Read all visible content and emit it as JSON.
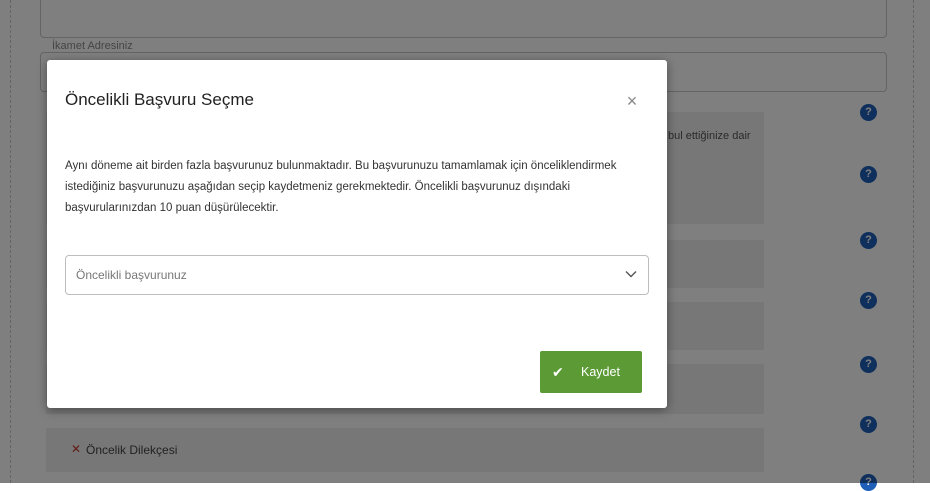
{
  "background": {
    "address_legend": "İkamet Adresiniz",
    "partial_text": "bul ettiğinize dair",
    "priority_row_label": "Öncelik Dilekçesi",
    "help_icon_glyph": "?",
    "remove_glyph": "✕"
  },
  "modal": {
    "title": "Öncelikli Başvuru Seçme",
    "close_glyph": "×",
    "message": "Aynı döneme ait birden fazla başvurunuz bulunmaktadır. Bu başvurunuzu tamamlamak için önceliklendirmek istediğiniz başvurunuzu aşağıdan seçip kaydetmeniz gerekmektedir. Öncelikli başvurunuz dışındaki başvurularınızdan 10 puan düşürülecektir.",
    "select": {
      "placeholder": "Öncelikli başvurunuz"
    },
    "save_button": {
      "label": "Kaydet",
      "icon": "check-icon"
    }
  },
  "colors": {
    "accent_green": "#5c9a35",
    "help_blue": "#1f5fb8",
    "remove_red": "#c0392b"
  }
}
